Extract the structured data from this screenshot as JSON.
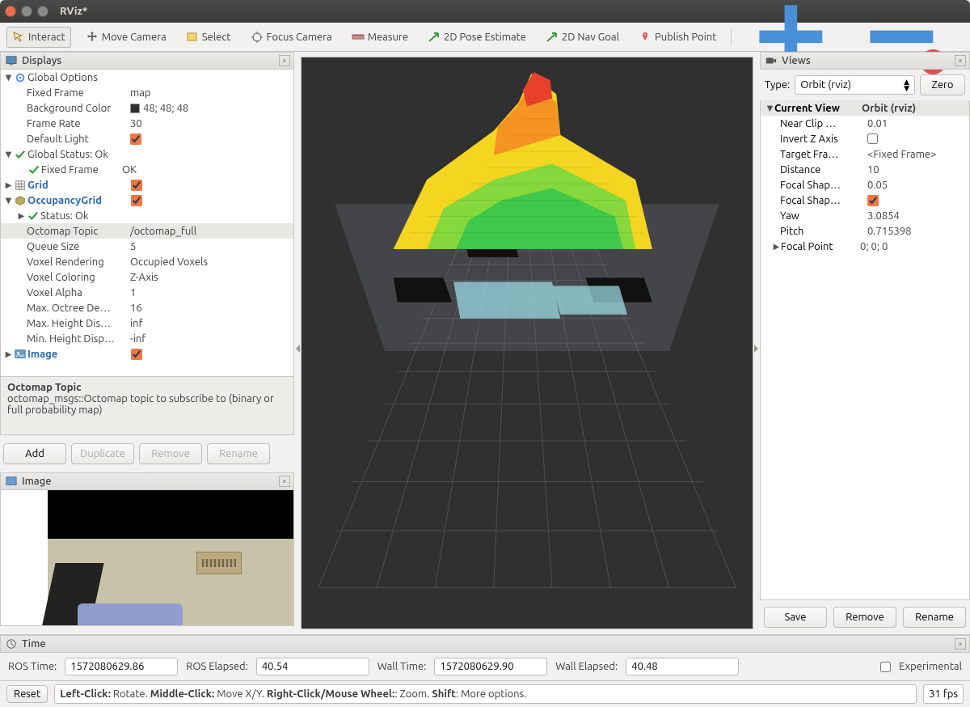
{
  "window": {
    "title": "RViz*"
  },
  "toolbar": {
    "interact": "Interact",
    "move_camera": "Move Camera",
    "select": "Select",
    "focus_camera": "Focus Camera",
    "measure": "Measure",
    "pose_estimate": "2D Pose Estimate",
    "nav_goal": "2D Nav Goal",
    "publish_point": "Publish Point"
  },
  "displays": {
    "title": "Displays",
    "global_options": {
      "label": "Global Options",
      "fixed_frame": {
        "k": "Fixed Frame",
        "v": "map"
      },
      "bg_color": {
        "k": "Background Color",
        "v": "48; 48; 48"
      },
      "frame_rate": {
        "k": "Frame Rate",
        "v": "30"
      },
      "default_light": {
        "k": "Default Light",
        "checked": true
      }
    },
    "global_status": {
      "label": "Global Status: Ok",
      "fixed_frame": {
        "k": "Fixed Frame",
        "v": "OK"
      }
    },
    "grid": {
      "label": "Grid",
      "checked": true
    },
    "occupancy": {
      "label": "OccupancyGrid",
      "checked": true,
      "status": "Status: Ok",
      "topic": {
        "k": "Octomap Topic",
        "v": "/octomap_full"
      },
      "queue": {
        "k": "Queue Size",
        "v": "5"
      },
      "voxel_rend": {
        "k": "Voxel Rendering",
        "v": "Occupied Voxels"
      },
      "voxel_color": {
        "k": "Voxel Coloring",
        "v": "Z-Axis"
      },
      "voxel_alpha": {
        "k": "Voxel Alpha",
        "v": "1"
      },
      "max_depth": {
        "k": "Max. Octree De…",
        "v": "16"
      },
      "max_height": {
        "k": "Max. Height Dis…",
        "v": "inf"
      },
      "min_height": {
        "k": "Min. Height Disp…",
        "v": "-inf"
      }
    },
    "image": {
      "label": "Image",
      "checked": true
    }
  },
  "description": {
    "title": "Octomap Topic",
    "body": "octomap_msgs::Octomap topic to subscribe to (binary or full probability map)"
  },
  "buttons": {
    "add": "Add",
    "duplicate": "Duplicate",
    "remove": "Remove",
    "rename": "Rename"
  },
  "image_panel": {
    "title": "Image"
  },
  "views": {
    "title": "Views",
    "type_label": "Type:",
    "type_value": "Orbit (rviz)",
    "zero": "Zero",
    "current_view": {
      "k": "Current View",
      "v": "Orbit (rviz)"
    },
    "rows": {
      "near_clip": {
        "k": "Near Clip …",
        "v": "0.01"
      },
      "invert_z": {
        "k": "Invert Z Axis",
        "checked": false
      },
      "target_frame": {
        "k": "Target Fra…",
        "v": "<Fixed Frame>"
      },
      "distance": {
        "k": "Distance",
        "v": "10"
      },
      "focal_shape_s": {
        "k": "Focal Shap…",
        "v": "0.05"
      },
      "focal_shape_f": {
        "k": "Focal Shap…",
        "checked": true
      },
      "yaw": {
        "k": "Yaw",
        "v": "3.0854"
      },
      "pitch": {
        "k": "Pitch",
        "v": "0.715398"
      },
      "focal_point": {
        "k": "Focal Point",
        "v": "0; 0; 0"
      }
    },
    "save": "Save",
    "remove": "Remove",
    "rename": "Rename"
  },
  "time": {
    "title": "Time",
    "ros_time_l": "ROS Time:",
    "ros_time_v": "1572080629.86",
    "ros_elapsed_l": "ROS Elapsed:",
    "ros_elapsed_v": "40.54",
    "wall_time_l": "Wall Time:",
    "wall_time_v": "1572080629.90",
    "wall_elapsed_l": "Wall Elapsed:",
    "wall_elapsed_v": "40.48",
    "experimental": "Experimental"
  },
  "status": {
    "reset": "Reset",
    "msg_left": "Left-Click:",
    "msg_left_v": " Rotate. ",
    "msg_mid": "Middle-Click:",
    "msg_mid_v": " Move X/Y. ",
    "msg_right": "Right-Click/Mouse Wheel:",
    "msg_right_v": ": Zoom. ",
    "msg_shift": "Shift",
    "msg_shift_v": ": More options.",
    "fps": "31 fps"
  }
}
